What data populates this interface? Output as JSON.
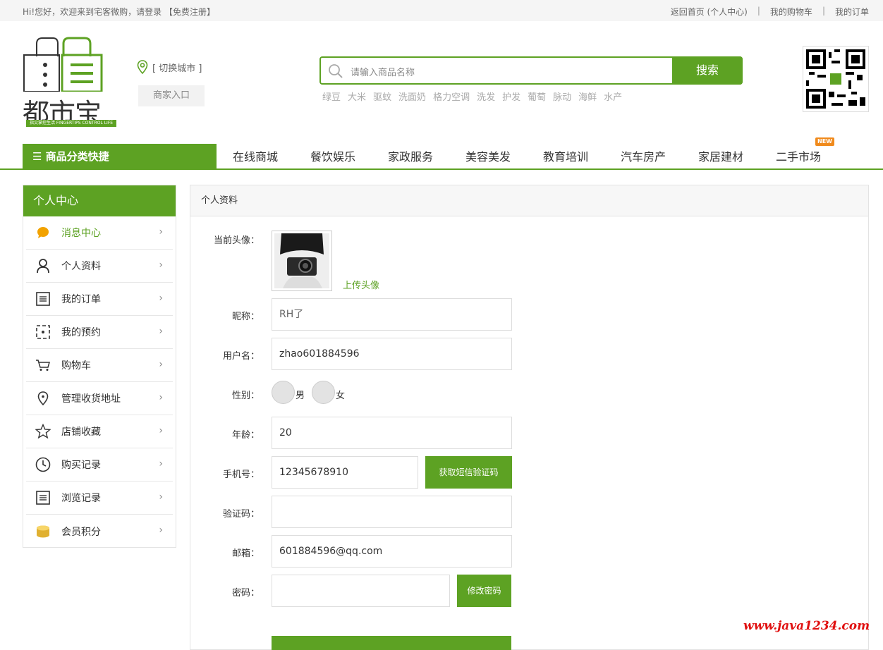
{
  "topbar": {
    "welcome": "Hi!您好，欢迎来到宅客微购，请登录 【免费注册】",
    "links": [
      "返回首页 (个人中心)",
      "我的购物车",
      "我的订单"
    ]
  },
  "logo": {
    "text": "都市宝",
    "slogan": "指尖掌控生活 FINGERTIPS CONTROL LIFE"
  },
  "city": "[ 切换城市 ]",
  "merchant": "商家入口",
  "search": {
    "placeholder": "请输入商品名称",
    "button": "搜索",
    "hotwords": [
      "绿豆",
      "大米",
      "驱蚊",
      "洗面奶",
      "格力空调",
      "洗发",
      "护发",
      "葡萄",
      "脉动",
      "海鲜",
      "水产"
    ]
  },
  "nav": {
    "category": "商品分类快捷",
    "items": [
      "在线商城",
      "餐饮娱乐",
      "家政服务",
      "美容美发",
      "教育培训",
      "汽车房产",
      "家居建材",
      "二手市场"
    ],
    "badge": "NEW"
  },
  "sidebar": {
    "title": "个人中心",
    "items": [
      {
        "label": "消息中心",
        "icon": "message-icon"
      },
      {
        "label": "个人资料",
        "icon": "user-icon"
      },
      {
        "label": "我的订单",
        "icon": "order-icon"
      },
      {
        "label": "我的预约",
        "icon": "reservation-icon"
      },
      {
        "label": "购物车",
        "icon": "cart-icon"
      },
      {
        "label": "管理收货地址",
        "icon": "location-icon"
      },
      {
        "label": "店铺收藏",
        "icon": "star-icon"
      },
      {
        "label": "购买记录",
        "icon": "clock-icon"
      },
      {
        "label": "浏览记录",
        "icon": "list-icon"
      },
      {
        "label": "会员积分",
        "icon": "coin-icon"
      }
    ]
  },
  "panel": {
    "title": "个人资料"
  },
  "form": {
    "avatar_label": "当前头像：",
    "upload": "上传头像",
    "nickname_label": "昵称：",
    "nickname": "RH了",
    "username_label": "用户名：",
    "username": "zhao601884596",
    "gender_label": "性别：",
    "gender_options": [
      "男",
      "女"
    ],
    "age_label": "年龄：",
    "age": "20",
    "phone_label": "手机号：",
    "phone": "12345678910",
    "sms_button": "获取短信验证码",
    "code_label": "验证码：",
    "code": "",
    "email_label": "邮箱：",
    "email": "601884596@qq.com",
    "password_label": "密码：",
    "password": "",
    "change_password": "修改密码"
  },
  "watermark": "www.java1234.com",
  "colors": {
    "accent": "#5da223",
    "badge": "#f08a1c",
    "watermark": "#e01010"
  }
}
